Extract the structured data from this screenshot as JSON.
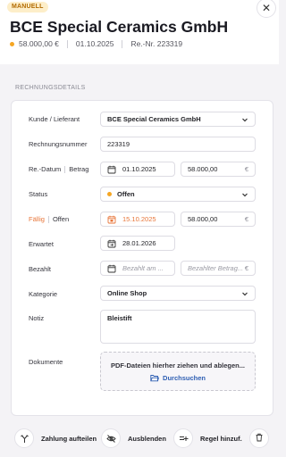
{
  "header": {
    "badge": "MANUELL",
    "title": "BCE Special Ceramics GmbH",
    "amount": "58.000,00 €",
    "date": "01.10.2025",
    "invoice_ref": "Re.-Nr. 223319"
  },
  "section_title": "RECHNUNGSDETAILS",
  "form": {
    "vendor": {
      "label": "Kunde / Lieferant",
      "value": "BCE Special Ceramics GmbH"
    },
    "invoice_number": {
      "label": "Rechnungsnummer",
      "value": "223319"
    },
    "invoice_date": {
      "label_date": "Re.-Datum",
      "label_amount": "Betrag",
      "date": "01.10.2025",
      "amount": "58.000,00",
      "currency": "€"
    },
    "status": {
      "label": "Status",
      "value": "Offen"
    },
    "due": {
      "label_due": "Fällig",
      "label_open": "Offen",
      "date": "15.10.2025",
      "amount": "58.000,00",
      "currency": "€"
    },
    "expected": {
      "label": "Erwartet",
      "date": "28.01.2026"
    },
    "paid": {
      "label": "Bezahlt",
      "date_placeholder": "Bezahlt am ...",
      "amount_placeholder": "Bezahlter Betrag...",
      "currency": "€"
    },
    "category": {
      "label": "Kategorie",
      "value": "Online Shop"
    },
    "note": {
      "label": "Notiz",
      "value": "Bleistift"
    },
    "documents": {
      "label": "Dokumente",
      "drop_text": "PDF-Dateien hierher ziehen und ablegen...",
      "browse": "Durchsuchen"
    }
  },
  "footer": {
    "split": "Zahlung aufteilen",
    "hide": "Ausblenden",
    "add_rule": "Regel hinzuf."
  },
  "colors": {
    "accent_orange": "#f5a623",
    "due_orange": "#e8763a",
    "link_blue": "#2f5fb3"
  }
}
